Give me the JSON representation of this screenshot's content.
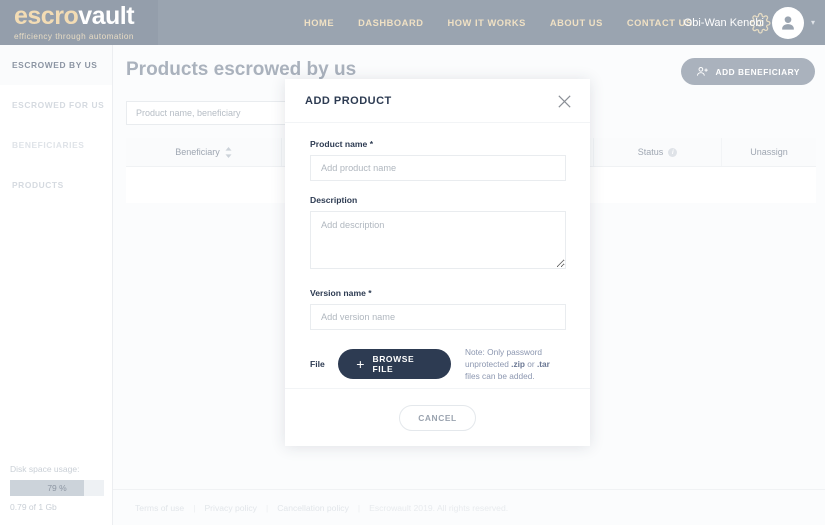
{
  "header": {
    "logo_primary": "escro",
    "logo_secondary": "vault",
    "logo_tagline": "efficiency through automation",
    "nav": [
      {
        "label": "HOME"
      },
      {
        "label": "DASHBOARD"
      },
      {
        "label": "HOW IT WORKS"
      },
      {
        "label": "ABOUT US"
      },
      {
        "label": "CONTACT US"
      }
    ],
    "settings_icon": "gear-icon",
    "user_name": "Obi-Wan Kenobi",
    "avatar_icon": "user-avatar-icon",
    "caret_icon": "chevron-down-icon",
    "bg_color": "#9aa4b0",
    "nav_color": "#f0e1c4"
  },
  "sidebar": {
    "items": [
      {
        "label": "ESCROWED BY US",
        "active": true
      },
      {
        "label": "ESCROWED FOR US",
        "active": false
      },
      {
        "label": "BENEFICIARIES",
        "active": false
      },
      {
        "label": "PRODUCTS",
        "active": false
      }
    ],
    "disk": {
      "label": "Disk space usage:",
      "percent_text": "79 %",
      "percent_value": 79,
      "detail": "0.79 of 1 Gb"
    }
  },
  "main": {
    "page_title": "Products escrowed by us",
    "add_beneficiary_label": "ADD BENEFICIARY",
    "add_beneficiary_icon": "add-user-icon",
    "search_placeholder": "Product name, beneficiary",
    "search_value": "",
    "table": {
      "columns": [
        {
          "label": "Beneficiary",
          "icon": "sort-icon"
        },
        {
          "label": "",
          "icon": ""
        },
        {
          "label": "",
          "icon": ""
        },
        {
          "label": "Status",
          "icon": "info-icon"
        },
        {
          "label": "Unassign",
          "icon": ""
        }
      ],
      "rows": []
    }
  },
  "modal": {
    "title": "ADD PRODUCT",
    "close_icon": "close-icon",
    "product_name": {
      "label": "Product name *",
      "placeholder": "Add product name",
      "value": ""
    },
    "description": {
      "label": "Description",
      "placeholder": "Add description",
      "value": ""
    },
    "version_name": {
      "label": "Version name *",
      "placeholder": "Add version name",
      "value": ""
    },
    "file": {
      "label": "File",
      "browse_label": "BROWSE FILE",
      "browse_icon": "plus-icon",
      "note_part1": "Note: Only password unprotected ",
      "note_zip": ".zip",
      "note_or": " or ",
      "note_tar": ".tar",
      "note_part2": " files can be added."
    },
    "cancel_label": "CANCEL"
  },
  "footer": {
    "links": [
      {
        "label": "Terms of use"
      },
      {
        "label": "Privacy policy"
      },
      {
        "label": "Cancellation policy"
      }
    ],
    "separator": "|",
    "copyright": "Escrowault 2019. All rights reserved."
  }
}
